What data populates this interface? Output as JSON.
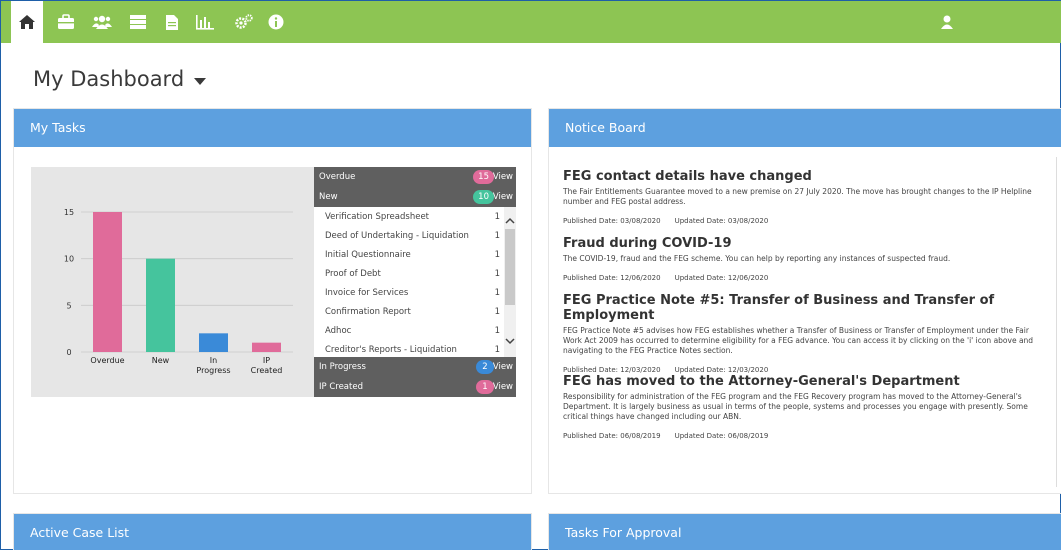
{
  "nav": {
    "icons": [
      "home-icon",
      "briefcase-icon",
      "users-icon",
      "server-icon",
      "document-icon",
      "bar-chart-icon",
      "cogs-icon",
      "info-icon"
    ],
    "user_icon": "user-icon"
  },
  "page": {
    "title": "My Dashboard"
  },
  "panels": {
    "my_tasks": "My Tasks",
    "notice_board": "Notice Board",
    "active_case_list": "Active Case List",
    "tasks_for_approval": "Tasks For Approval"
  },
  "chart_data": {
    "type": "bar",
    "categories": [
      "Overdue",
      "New",
      "In Progress",
      "IP Created"
    ],
    "values": [
      15,
      10,
      2,
      1
    ],
    "ylim": [
      0,
      15
    ],
    "yticks": [
      0,
      5,
      10,
      15
    ],
    "colors": [
      "#e06b9a",
      "#45c49d",
      "#3a8ad8",
      "#e06b9a"
    ],
    "xlabel": "",
    "ylabel": ""
  },
  "tasks": {
    "overdue": {
      "label": "Overdue",
      "count": "15",
      "view": "View",
      "color": "#e06b9a"
    },
    "new": {
      "label": "New",
      "count": "10",
      "view": "View",
      "color": "#45c49d"
    },
    "in_progress": {
      "label": "In Progress",
      "count": "2",
      "view": "View",
      "color": "#3a8ad8"
    },
    "ip_created": {
      "label": "IP Created",
      "count": "1",
      "view": "View",
      "color": "#e06b9a"
    },
    "new_items": [
      {
        "name": "Verification Spreadsheet",
        "count": "1"
      },
      {
        "name": "Deed of Undertaking - Liquidation",
        "count": "1"
      },
      {
        "name": "Initial Questionnaire",
        "count": "1"
      },
      {
        "name": "Proof of Debt",
        "count": "1"
      },
      {
        "name": "Invoice for Services",
        "count": "1"
      },
      {
        "name": "Confirmation Report",
        "count": "1"
      },
      {
        "name": "Adhoc",
        "count": "1"
      },
      {
        "name": "Creditor's Reports - Liquidation",
        "count": "1"
      }
    ]
  },
  "notices": [
    {
      "title": "FEG contact details have changed",
      "body": "The Fair Entitlements Guarantee moved to a new premise on 27 July 2020. The move has brought changes to the IP Helpline number and FEG postal address.",
      "published": "Published Date: 03/08/2020",
      "updated": "Updated Date: 03/08/2020"
    },
    {
      "title": "Fraud during COVID-19",
      "body": "The COVID-19, fraud and the FEG scheme. You can help by reporting any instances of suspected fraud.",
      "published": "Published Date: 12/06/2020",
      "updated": "Updated Date: 12/06/2020"
    },
    {
      "title": "FEG Practice Note #5: Transfer of Business and Transfer of Employment",
      "body": "FEG Practice Note #5 advises how FEG establishes whether a Transfer of Business or Transfer of Employment under the Fair Work Act 2009 has occurred to determine eligibility for a FEG advance. You can access it by clicking on the 'i' icon above and navigating to the FEG Practice Notes section.",
      "published": "Published Date: 12/03/2020",
      "updated": "Updated Date: 12/03/2020"
    },
    {
      "title": "FEG has moved to the Attorney-General's Department",
      "body": "Responsibility for administration of the FEG program and the FEG Recovery program has moved to the Attorney-General's Department. It is largely business as usual in terms of the people, systems and processes you engage with presently. Some critical things have changed including our ABN.",
      "published": "Published Date: 06/08/2019",
      "updated": "Updated Date: 06/08/2019"
    }
  ]
}
